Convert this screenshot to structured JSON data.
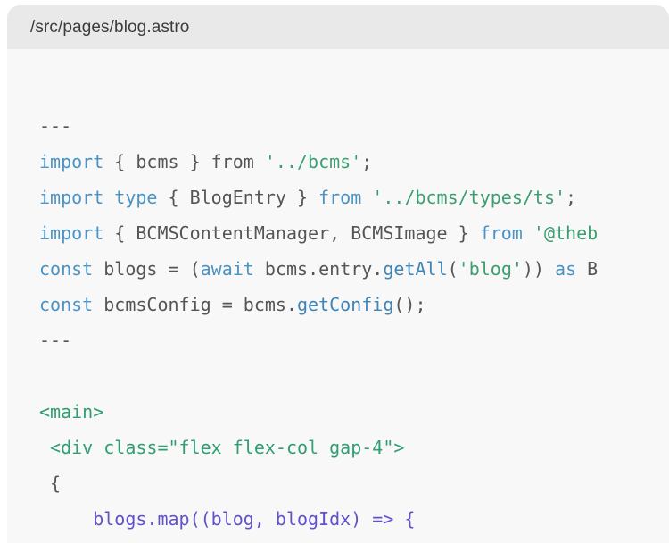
{
  "card": {
    "file_path": "/src/pages/blog.astro",
    "header_bg": "#e9e9e9",
    "body_bg": "#f8f8f8"
  },
  "colors": {
    "keyword": "#4a93c4",
    "string": "#3c9e70",
    "function": "#3f85b8",
    "tag": "#2f9e70",
    "arrow_function": "#5f52cc",
    "plain": "#555555"
  },
  "code": {
    "language": "astro",
    "lines": [
      {
        "id": "l1",
        "tokens": [
          {
            "t": "---",
            "c": "plain"
          }
        ]
      },
      {
        "id": "l2",
        "tokens": [
          {
            "t": "import",
            "c": "keyword"
          },
          {
            "t": " { bcms } ",
            "c": "plain"
          },
          {
            "t": "from",
            "c": "plain"
          },
          {
            "t": " '../bcms'",
            "c": "string"
          },
          {
            "t": ";",
            "c": "plain"
          }
        ]
      },
      {
        "id": "l3",
        "tokens": [
          {
            "t": "import",
            "c": "keyword"
          },
          {
            "t": " ",
            "c": "plain"
          },
          {
            "t": "type",
            "c": "keyword"
          },
          {
            "t": " { BlogEntry } ",
            "c": "plain"
          },
          {
            "t": "from",
            "c": "keyword"
          },
          {
            "t": " '../bcms/types/ts'",
            "c": "string"
          },
          {
            "t": ";",
            "c": "plain"
          }
        ]
      },
      {
        "id": "l4",
        "tokens": [
          {
            "t": "import",
            "c": "keyword"
          },
          {
            "t": " { BCMSContentManager, BCMSImage } ",
            "c": "plain"
          },
          {
            "t": "from",
            "c": "keyword"
          },
          {
            "t": " '@theb",
            "c": "string"
          }
        ]
      },
      {
        "id": "l5",
        "tokens": [
          {
            "t": "const",
            "c": "keyword"
          },
          {
            "t": " blogs = (",
            "c": "plain"
          },
          {
            "t": "await",
            "c": "keyword"
          },
          {
            "t": " bcms.entry.",
            "c": "plain"
          },
          {
            "t": "getAll",
            "c": "function"
          },
          {
            "t": "(",
            "c": "plain"
          },
          {
            "t": "'blog'",
            "c": "string"
          },
          {
            "t": ")) ",
            "c": "plain"
          },
          {
            "t": "as",
            "c": "keyword"
          },
          {
            "t": " B",
            "c": "plain"
          }
        ]
      },
      {
        "id": "l6",
        "tokens": [
          {
            "t": "const",
            "c": "keyword"
          },
          {
            "t": " bcmsConfig = bcms.",
            "c": "plain"
          },
          {
            "t": "getConfig",
            "c": "function"
          },
          {
            "t": "();",
            "c": "plain"
          }
        ]
      },
      {
        "id": "l7",
        "tokens": [
          {
            "t": "---",
            "c": "plain"
          }
        ]
      },
      {
        "id": "l8",
        "tokens": []
      },
      {
        "id": "l9",
        "tokens": [
          {
            "t": "<main>",
            "c": "tag"
          }
        ]
      },
      {
        "id": "l10",
        "tokens": [
          {
            "t": " <div class=\"flex flex-col gap-4\">",
            "c": "tag"
          }
        ]
      },
      {
        "id": "l11",
        "tokens": [
          {
            "t": " {",
            "c": "plain"
          }
        ]
      },
      {
        "id": "l12",
        "tokens": [
          {
            "t": "     blogs.map((blog, blogIdx) => {",
            "c": "arrow_function"
          }
        ]
      }
    ]
  }
}
